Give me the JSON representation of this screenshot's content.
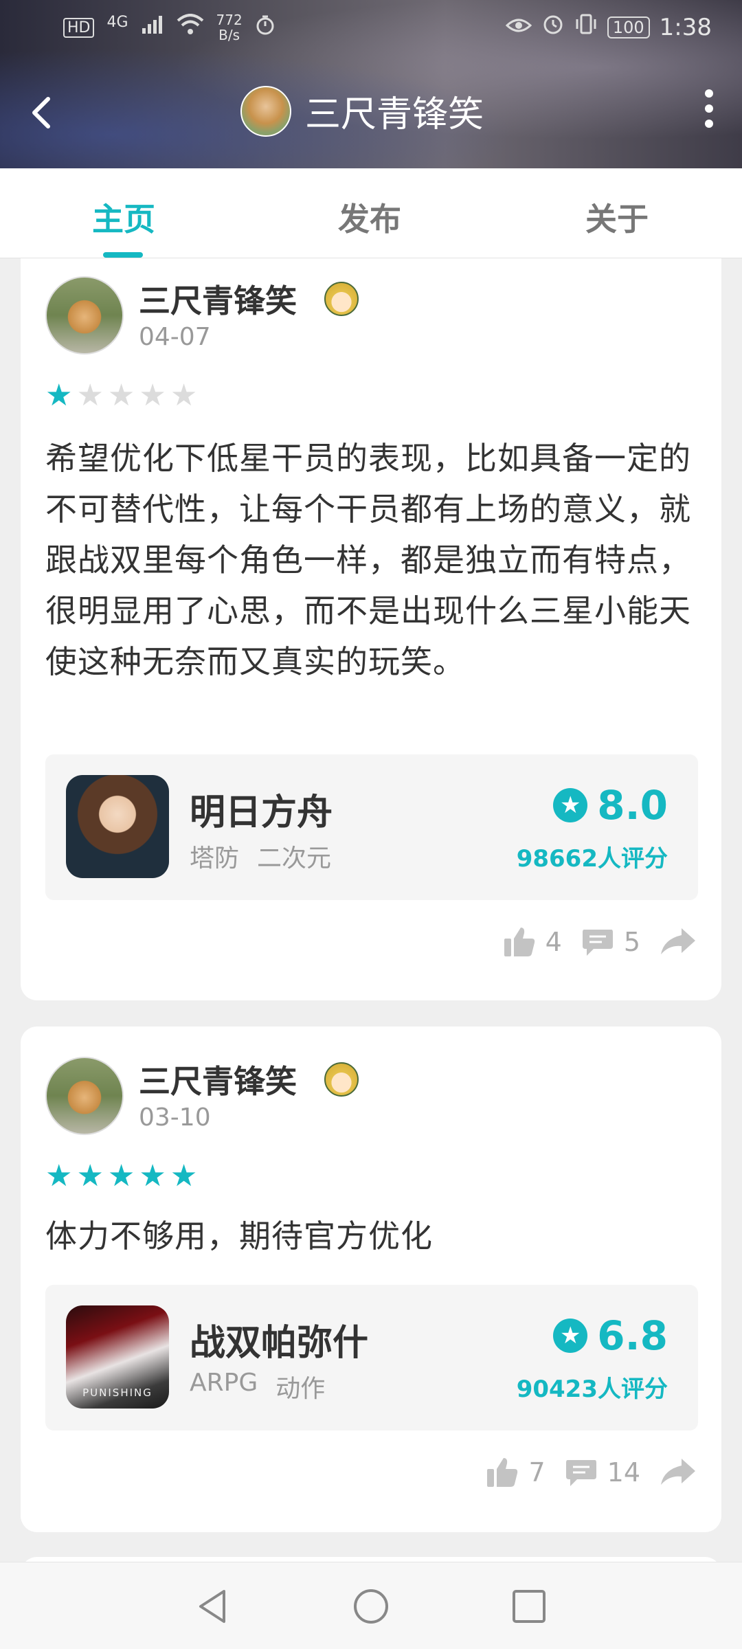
{
  "status_bar": {
    "left_badge": "HD",
    "network": "4G",
    "speed_value": "772",
    "speed_unit": "B/s",
    "battery": "100",
    "time": "1:38"
  },
  "header": {
    "title": "三尺青锋笑"
  },
  "tabs": [
    {
      "label": "主页",
      "active": true
    },
    {
      "label": "发布",
      "active": false
    },
    {
      "label": "关于",
      "active": false
    }
  ],
  "posts": [
    {
      "username": "三尺青锋笑",
      "date": "04-07",
      "rating": 1,
      "content": "希望优化下低星干员的表现，比如具备一定的不可替代性，让每个干员都有上场的意义，就跟战双里每个角色一样，都是独立而有特点，很明显用了心思，而不是出现什么三星小能天使这种无奈而又真实的玩笑。",
      "game": {
        "name": "明日方舟",
        "tags": [
          "塔防",
          "二次元"
        ],
        "score": "8.0",
        "ratings": "98662人评分"
      },
      "likes": "4",
      "comments": "5"
    },
    {
      "username": "三尺青锋笑",
      "date": "03-10",
      "rating": 5,
      "content": "体力不够用，期待官方优化",
      "game": {
        "name": "战双帕弥什",
        "tags": [
          "ARPG",
          "动作"
        ],
        "score": "6.8",
        "ratings": "90423人评分",
        "icon_text": "PUNISHING"
      },
      "likes": "7",
      "comments": "14"
    }
  ],
  "colors": {
    "accent": "#15b8c2"
  }
}
